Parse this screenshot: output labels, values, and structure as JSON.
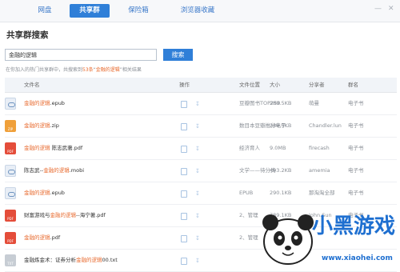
{
  "tabs": {
    "wangpan": "网盘",
    "share_group": "共享群",
    "safe": "保险箱",
    "browser_fav": "浏览器收藏"
  },
  "page_title": "共享群搜索",
  "search": {
    "value": "金融的逻辑",
    "button": "搜索"
  },
  "search_info": {
    "prefix": "在你加入的热门共享群中，共搜索到",
    "count": "53条",
    "middle": "“",
    "keyword": "金融的逻辑",
    "suffix": "”相关结果"
  },
  "columns": {
    "name": "文件名",
    "action": "操作",
    "position": "文件位置",
    "size": "大小",
    "sharer": "分享者",
    "group": "群名"
  },
  "files": [
    {
      "icon": "cloud",
      "pre": "",
      "hl": "金融的逻辑",
      "post": ".epub",
      "position": "豆瓣图书TOP250",
      "size": "289.5KB",
      "sharer": "萌曼",
      "group": "电子书"
    },
    {
      "icon": "zip",
      "pre": "",
      "hl": "金融的逻辑",
      "post": ".zip",
      "position": "数目本豆瓣推分电子...",
      "size": "289.5KB",
      "sharer": "Chandler.lun",
      "group": "电子书"
    },
    {
      "icon": "pdf",
      "pre": "",
      "hl": "金融的逻辑",
      "post": " 陈志武著.pdf",
      "position": "经济育人",
      "size": "9.0MB",
      "sharer": "firecash",
      "group": "电子书"
    },
    {
      "icon": "cloud",
      "pre": "陈志武--",
      "hl": "金融的逻辑",
      "post": ".mobi",
      "position": "文学——待分类",
      "size": "493.2KB",
      "sharer": "amemia",
      "group": "电子书"
    },
    {
      "icon": "cloud",
      "pre": "",
      "hl": "金融的逻辑",
      "post": ".epub",
      "position": "EPUB",
      "size": "290.1KB",
      "sharer": "那淘淘全部",
      "group": "电子书"
    },
    {
      "icon": "pdf",
      "pre": "财富游戏与",
      "hl": "金融的逻辑",
      "post": "--海宁著.pdf",
      "position": "2、管理",
      "size": "789.1KB",
      "sharer": "John.Sun",
      "group": "电子书"
    },
    {
      "icon": "pdf",
      "pre": "",
      "hl": "金融的逻辑",
      "post": ".pdf",
      "position": "2、管理",
      "size": "",
      "sharer": "",
      "group": ""
    },
    {
      "icon": "txt",
      "pre": "金融炼金术：证券分析",
      "hl": "金融的逻辑",
      "post": "00.txt",
      "position": "",
      "size": "",
      "sharer": "",
      "group": ""
    }
  ],
  "watermark": {
    "title": "小黑游戏",
    "url": "www.xiaohei.com"
  }
}
